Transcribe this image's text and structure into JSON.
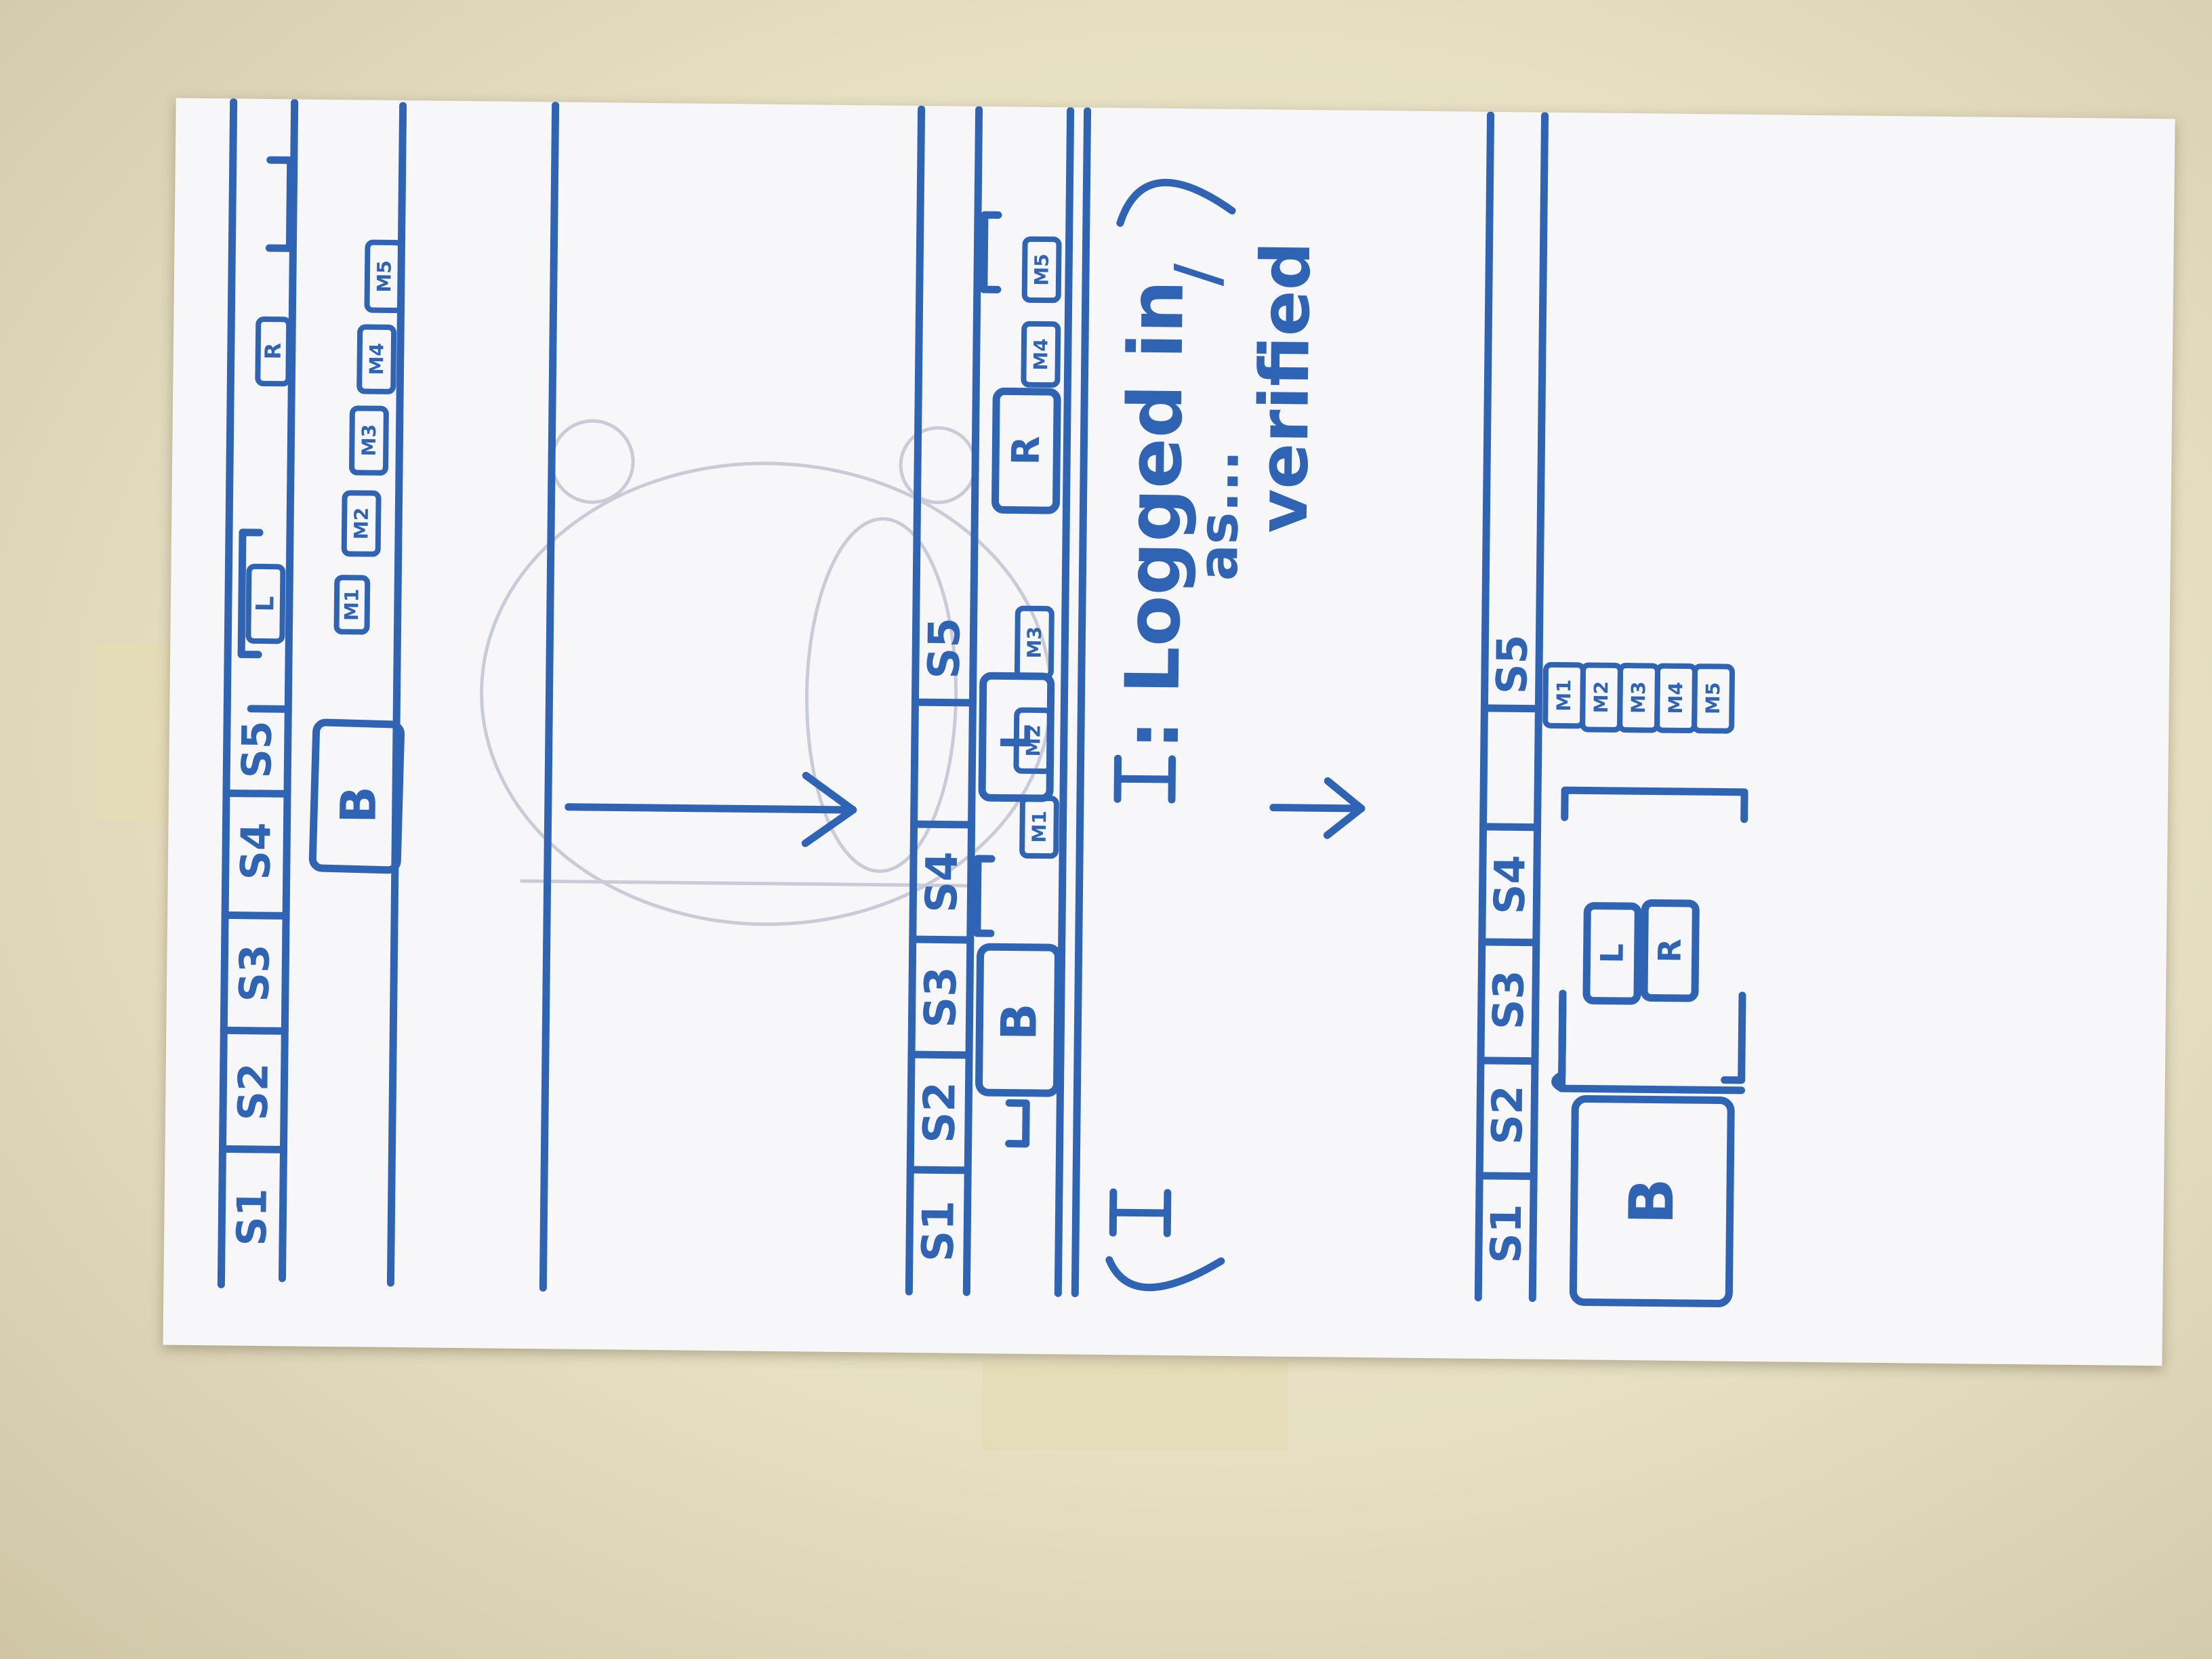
{
  "frame1": {
    "tabs": [
      "S1",
      "S2",
      "S3",
      "S4",
      "S5"
    ],
    "body_box": "B",
    "left_box": "L",
    "right_box": "R",
    "modules": [
      "M1",
      "M2",
      "M3",
      "M4",
      "M5"
    ]
  },
  "arrow1": "→",
  "frame2": {
    "tabs": [
      "S1",
      "S2",
      "S3",
      "S4",
      "S5"
    ],
    "body_box": "B",
    "left_box": "L",
    "right_box": "R",
    "modules_left": [
      "M1",
      "M2",
      "M3"
    ],
    "modules_right": [
      "M4",
      "M5"
    ]
  },
  "note": {
    "bracket_open": "[",
    "bracket_close": "]",
    "text_line1": ": Logged in",
    "text_line2": "as...",
    "slash": "/",
    "text_line3": "verified"
  },
  "arrow2": "→",
  "frame3": {
    "tabs": [
      "S1",
      "S2",
      "S3",
      "S4",
      "S5"
    ],
    "body_box": "B",
    "left_box": "L",
    "right_box": "R",
    "modules": [
      "M1",
      "M2",
      "M3",
      "M4",
      "M5"
    ]
  },
  "colors": {
    "ink": "#2f63b3",
    "paper": "#f7f6f8",
    "wall": "#e6dfc2"
  }
}
